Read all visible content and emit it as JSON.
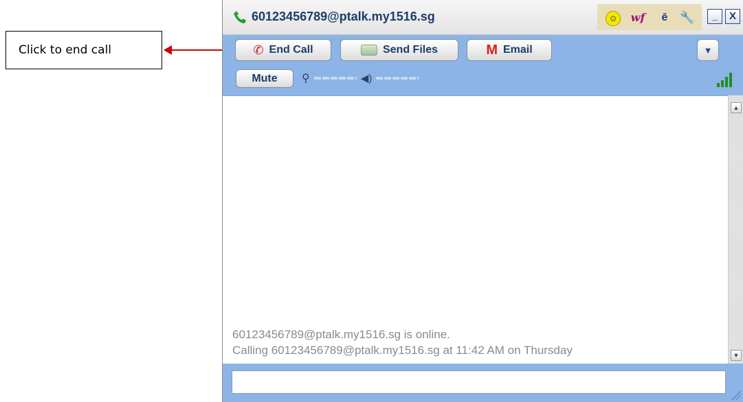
{
  "callout": {
    "text": "Click to end call"
  },
  "window": {
    "title": "60123456789@ptalk.my1516.sg",
    "tools": {
      "smiley_glyph": "☺",
      "wf_label": "wf",
      "doc_glyph": "ē",
      "wrench_glyph": "🔧"
    },
    "minimize_label": "_",
    "close_label": "X"
  },
  "toolbar": {
    "end_call_label": "End Call",
    "send_files_label": "Send Files",
    "email_label": "Email",
    "email_icon_glyph": "M",
    "dropdown_glyph": "▼",
    "mute_label": "Mute"
  },
  "chat": {
    "lines": [
      "60123456789@ptalk.my1516.sg is online.",
      "Calling 60123456789@ptalk.my1516.sg at 11:42 AM on Thursday"
    ]
  },
  "message_input": {
    "value": "",
    "placeholder": ""
  },
  "colors": {
    "toolbar_bg": "#8db4e6",
    "title_text": "#1d3c6a",
    "end_call_icon": "#c8201e",
    "arrow": "#d00000"
  }
}
